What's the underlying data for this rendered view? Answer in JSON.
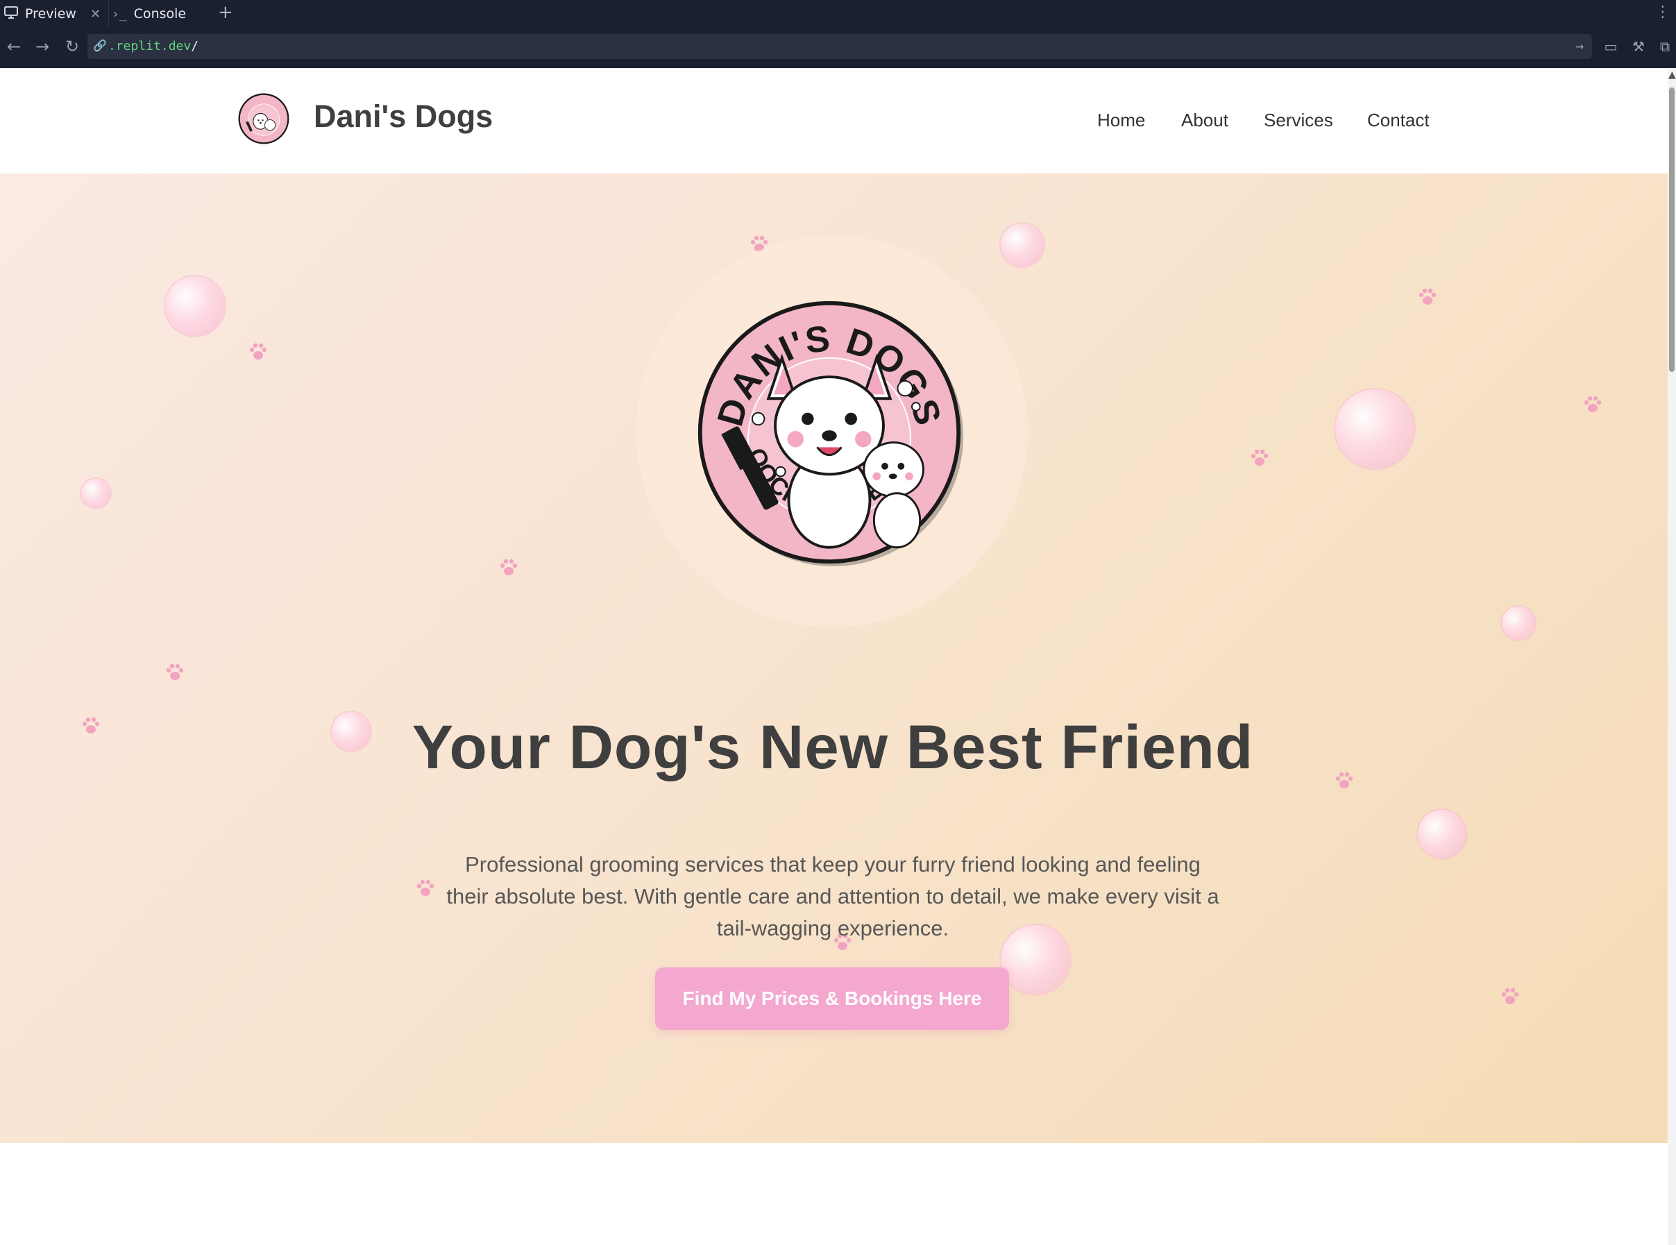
{
  "browser": {
    "tabs": [
      {
        "label": "Preview",
        "active": true
      },
      {
        "label": "Console",
        "active": false
      }
    ],
    "url_domain": ".replit.dev",
    "url_path": "/"
  },
  "site": {
    "brand_name": "Dani's Dogs",
    "nav": [
      "Home",
      "About",
      "Services",
      "Contact"
    ]
  },
  "hero": {
    "title": "Your Dog's New Best Friend",
    "subtitle": "Professional grooming services that keep your furry friend looking and feeling their absolute best. With gentle care and attention to detail, we make every visit a tail-wagging experience.",
    "cta_label": "Find My Prices & Bookings Here"
  },
  "logo_text": {
    "top": "DANI'S DOGS",
    "bottom": "POOCH PAMPERING"
  },
  "colors": {
    "accent": "#f4a7cf",
    "heading": "#3f3f3f",
    "browser_bar": "#1b2031",
    "url_green": "#5fd47d"
  }
}
